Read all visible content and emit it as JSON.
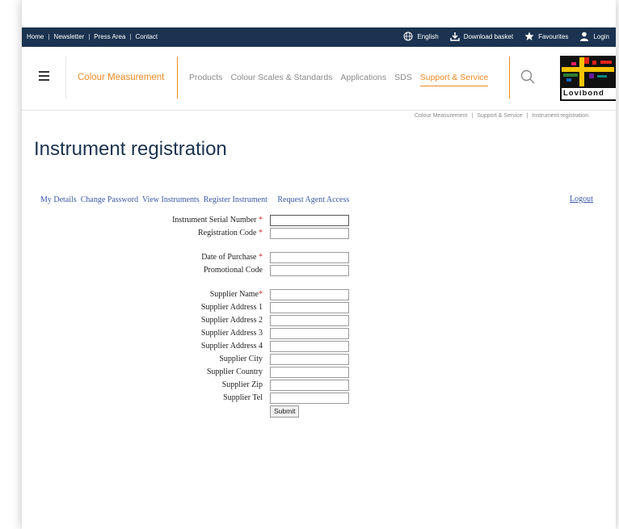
{
  "topbar": {
    "left_links": [
      "Home",
      "Newsletter",
      "Press Area",
      "Contact"
    ],
    "language": "English",
    "download": "Download basket",
    "favourites": "Favourites",
    "login": "Login"
  },
  "nav": {
    "section": "Colour Measurement",
    "items": [
      "Products",
      "Colour Scales & Standards",
      "Applications",
      "SDS",
      "Support & Service"
    ],
    "active_item": "Support & Service",
    "logo_text": "Lovibond"
  },
  "breadcrumb": [
    "Colour Measurement",
    "Support & Service",
    "Instrument registration"
  ],
  "page_title": "Instrument registration",
  "subnav": {
    "links": [
      "My Details",
      "Change Password",
      "View Instruments",
      "Register Instrument",
      "Request Agent Access"
    ],
    "logout": "Logout"
  },
  "form": {
    "fields": [
      {
        "label": "Instrument Serial Number",
        "required": "*"
      },
      {
        "label": "Registration Code",
        "required": "*"
      },
      {
        "label": "Date of Purchase",
        "required": "*"
      },
      {
        "label": "Promotional Code",
        "required": ""
      },
      {
        "label": "Supplier Name",
        "required": "*"
      },
      {
        "label": "Supplier Address 1",
        "required": ""
      },
      {
        "label": "Supplier Address 2",
        "required": ""
      },
      {
        "label": "Supplier Address 3",
        "required": ""
      },
      {
        "label": "Supplier Address 4",
        "required": ""
      },
      {
        "label": "Supplier City",
        "required": ""
      },
      {
        "label": "Supplier Country",
        "required": ""
      },
      {
        "label": "Supplier Zip",
        "required": ""
      },
      {
        "label": "Supplier Tel",
        "required": ""
      }
    ],
    "submit_label": "Submit"
  },
  "colors": {
    "navy": "#1b3350",
    "accent": "#f08a24",
    "link": "#3a59a8",
    "required": "#dd3333"
  }
}
